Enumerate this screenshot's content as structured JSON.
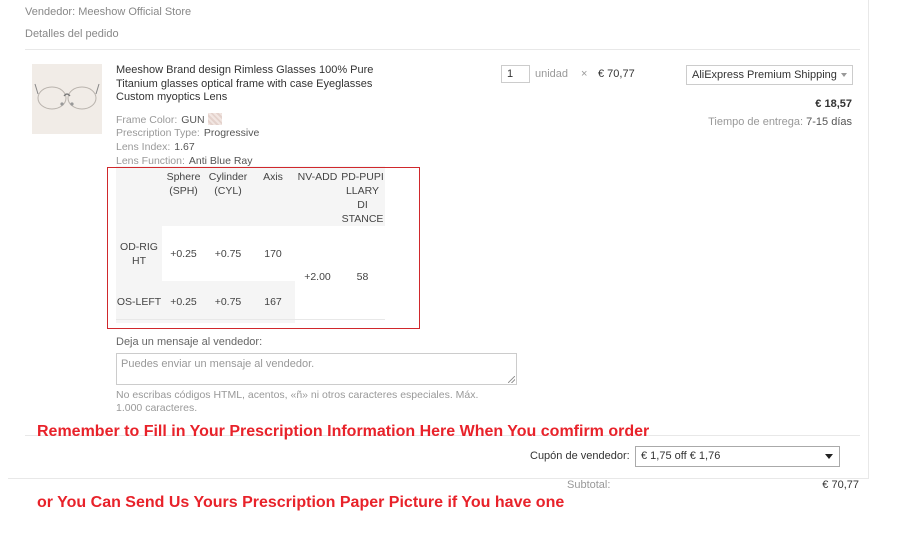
{
  "store": {
    "vendor_line": "Vendedor: Meeshow Official Store",
    "details_label": "Detalles del pedido"
  },
  "product": {
    "title": "Meeshow Brand design Rimless Glasses 100% Pure Titanium glasses optical frame with case Eyeglasses Custom myoptics Lens",
    "image_icon": "glasses-thumbnail",
    "attributes": [
      {
        "label": "Frame Color:",
        "value": "GUN"
      },
      {
        "label": "Prescription Type:",
        "value": "Progressive"
      },
      {
        "label": "Lens Index:",
        "value": "1.67"
      },
      {
        "label": "Lens Function:",
        "value": "Anti Blue Ray"
      }
    ],
    "quantity": "1",
    "unit_label": "unidad",
    "times": "×",
    "unit_price": "€ 70,77"
  },
  "shipping": {
    "method": "AliExpress Premium Shipping",
    "cost": "€ 18,57",
    "delivery_label": "Tiempo de entrega:",
    "delivery_value": "7-15 días"
  },
  "prescription": {
    "headers": [
      "",
      "Sphere\n(SPH)",
      "Cylinder\n(CYL)",
      "Axis",
      "NV-ADD",
      "PD-PUPI\nLLARY DI\nSTANCE"
    ],
    "rows": [
      {
        "eye": "OD-RIG\nHT",
        "sph": "+0.25",
        "cyl": "+0.75",
        "axis": "170"
      },
      {
        "eye": "OS-LEFT",
        "sph": "+0.25",
        "cyl": "+0.75",
        "axis": "167"
      }
    ],
    "nv_add": "+2.00",
    "pd": "58",
    "highlight_color": "#d0282c"
  },
  "message": {
    "label": "Deja un mensaje al vendedor:",
    "placeholder": "Puedes enviar un mensaje al vendedor.",
    "hint": "No escribas códigos HTML, acentos, «ñ» ni otros caracteres especiales. Máx. 1.000 caracteres."
  },
  "annotations": {
    "line1": "Remember to Fill in Your Prescription Information Here When You comfirm order",
    "line2": "or You Can Send Us Yours Prescription Paper Picture if You have one",
    "color": "#e8222a"
  },
  "coupon": {
    "label": "Cupón de vendedor:",
    "selected": "€ 1,75 off € 1,76"
  },
  "totals": {
    "subtotal_label": "Subtotal:",
    "subtotal_value": "€ 70,77"
  }
}
